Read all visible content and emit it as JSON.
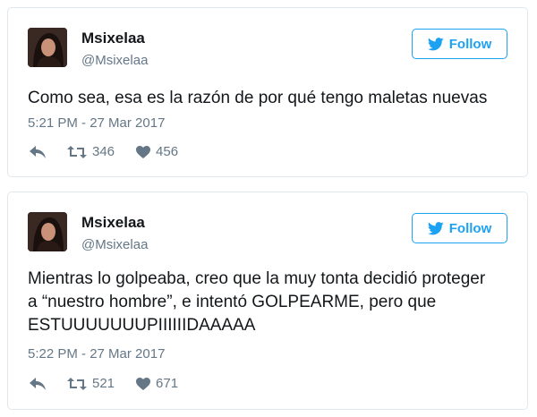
{
  "colors": {
    "accent": "#1da1f2",
    "text_primary": "#14171a",
    "text_secondary": "#657786",
    "border": "#e1e8ed"
  },
  "tweets": [
    {
      "name": "Msixelaa",
      "handle": "@Msixelaa",
      "follow_label": "Follow",
      "text": "Como sea, esa es la razón de por qué tengo maletas nuevas",
      "timestamp": "5:21 PM - 27 Mar 2017",
      "retweets": "346",
      "likes": "456",
      "icons": {
        "reply": "reply-icon",
        "retweet": "retweet-icon",
        "like": "heart-icon",
        "follow": "twitter-bird-icon"
      }
    },
    {
      "name": "Msixelaa",
      "handle": "@Msixelaa",
      "follow_label": "Follow",
      "text_lines": [
        "Mientras lo golpeaba, creo que la muy tonta decidió proteger",
        "a “nuestro hombre”, e intentó GOLPEARME, pero que",
        "ESTUUUUUUUPIIIIIIDAAAAA"
      ],
      "timestamp": "5:22 PM - 27 Mar 2017",
      "retweets": "521",
      "likes": "671",
      "icons": {
        "reply": "reply-icon",
        "retweet": "retweet-icon",
        "like": "heart-icon",
        "follow": "twitter-bird-icon"
      }
    }
  ]
}
